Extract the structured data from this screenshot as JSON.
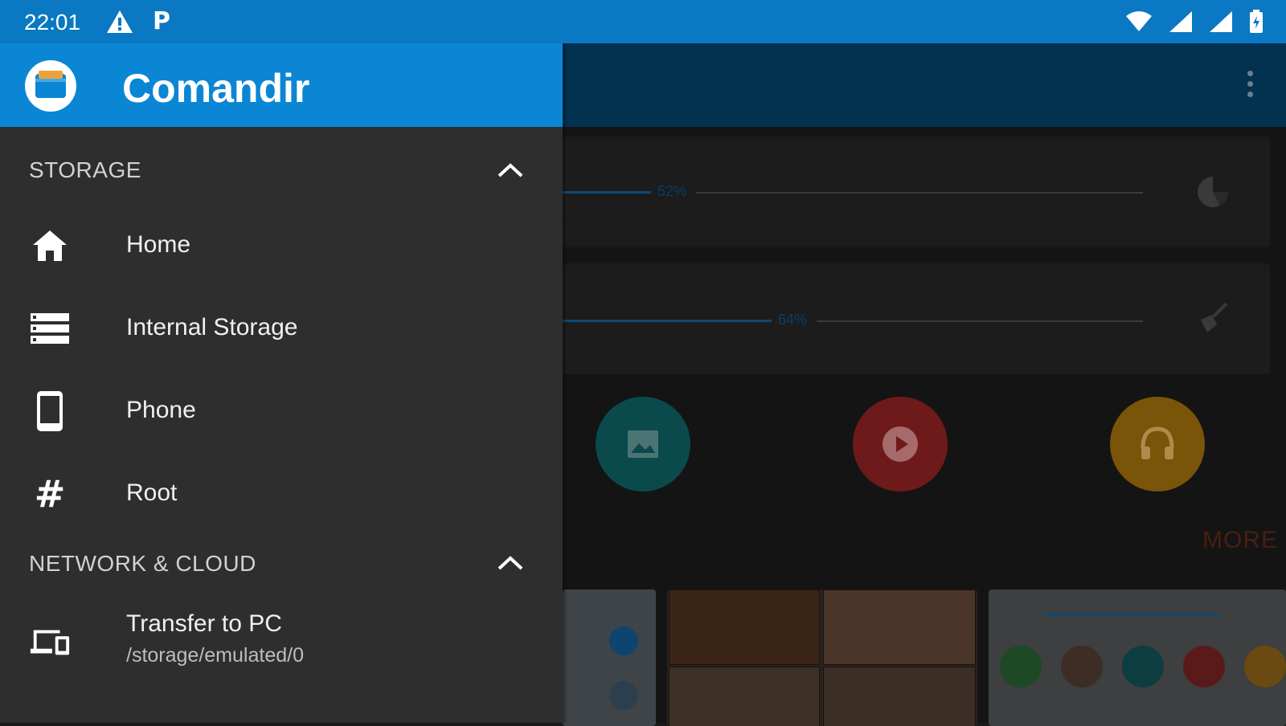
{
  "status_bar": {
    "time": "22:01",
    "notification_icons": [
      "warning-icon",
      "parking-icon"
    ],
    "system_icons": [
      "wifi-icon",
      "signal-icon",
      "signal-icon",
      "battery-icon"
    ]
  },
  "drawer": {
    "app_name": "Comandir",
    "sections": [
      {
        "title": "STORAGE",
        "expanded": true,
        "items": [
          {
            "label": "Home",
            "icon": "home-icon"
          },
          {
            "label": "Internal Storage",
            "icon": "storage-icon"
          },
          {
            "label": "Phone",
            "icon": "phone-icon"
          },
          {
            "label": "Root",
            "icon": "hash-icon"
          }
        ]
      },
      {
        "title": "NETWORK & CLOUD",
        "expanded": true,
        "items": [
          {
            "label": "Transfer to PC",
            "subtitle": "/storage/emulated/0",
            "icon": "devices-icon"
          }
        ]
      }
    ]
  },
  "background_app": {
    "storage_bars": [
      {
        "percent_label": "52%",
        "percent": 52,
        "icon": "pie-chart-icon"
      },
      {
        "percent_label": "64%",
        "percent": 64,
        "icon": "broom-icon"
      }
    ],
    "category_buttons": [
      {
        "icon": "image-icon",
        "color": "#0a4a4c"
      },
      {
        "icon": "play-icon",
        "color": "#6e1a1a"
      },
      {
        "icon": "headphones-icon",
        "color": "#7a5409"
      }
    ],
    "more_label": "MORE"
  },
  "colors": {
    "status_bar": "#0a78c2",
    "drawer_header": "#0a86d4",
    "drawer_bg": "#2e2e2e"
  }
}
